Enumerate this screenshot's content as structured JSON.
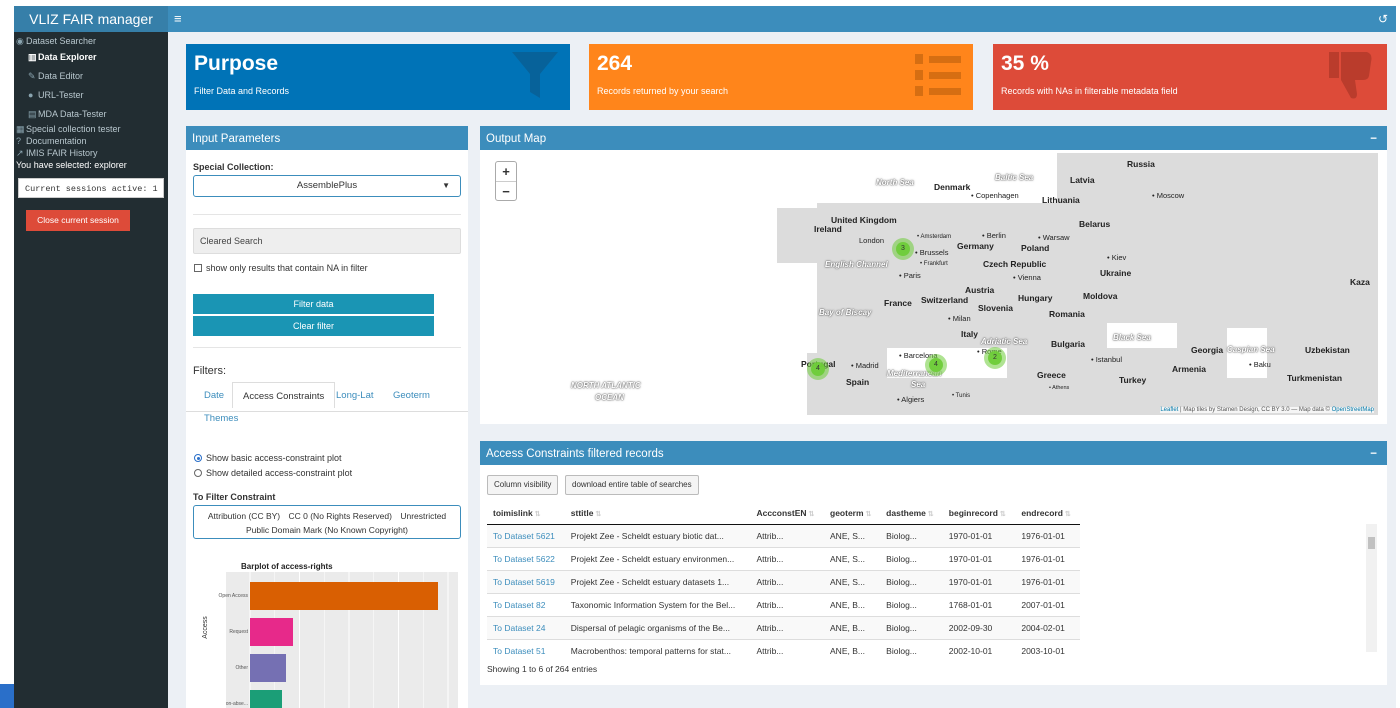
{
  "app": {
    "title": "VLIZ FAIR manager"
  },
  "sidebar": {
    "items": [
      {
        "label": "Dataset Searcher",
        "icon": "eye-icon"
      },
      {
        "label": "Data Explorer",
        "icon": "map-icon"
      },
      {
        "label": "Data Editor",
        "icon": "edit-icon"
      },
      {
        "label": "URL-Tester",
        "icon": "globe-icon"
      },
      {
        "label": "MDA Data-Tester",
        "icon": "database-icon"
      },
      {
        "label": "Special collection tester",
        "icon": "table-icon"
      },
      {
        "label": "Documentation",
        "icon": "question-icon"
      },
      {
        "label": "IMIS FAIR History",
        "icon": "chart-icon"
      }
    ],
    "selected_text": "You have selected: explorer",
    "sessions_text": "Current sessions active: 1",
    "close_session_label": "Close current session"
  },
  "infoboxes": {
    "purpose": {
      "title": "Purpose",
      "subtitle": "Filter Data and Records",
      "color": "#0073b7"
    },
    "records": {
      "title": "264",
      "subtitle": "Records returned by your search",
      "color": "#ff851b"
    },
    "na": {
      "title": "35 %",
      "subtitle": "Records with NAs in filterable metadata field",
      "color": "#dd4b39"
    }
  },
  "input_params": {
    "title": "Input Parameters",
    "special_collection_label": "Special Collection:",
    "special_collection_value": "AssemblePlus",
    "search_value": "Cleared Search",
    "na_checkbox_label": "show only results that contain NA in filter",
    "filter_button": "Filter data",
    "clear_button": "Clear filter",
    "filters_label": "Filters:",
    "tabs": [
      "Date",
      "Access Constraints",
      "Long-Lat",
      "Geoterm",
      "Themes"
    ],
    "active_tab": "Access Constraints",
    "radio_basic": "Show basic access-constraint plot",
    "radio_detailed": "Show detailed access-constraint plot",
    "to_filter_label": "To Filter Constraint",
    "constraints": [
      "Attribution (CC BY)",
      "CC 0 (No Rights Reserved)",
      "Unrestricted",
      "Public Domain Mark (No Known Copyright)"
    ]
  },
  "chart_data": {
    "type": "bar",
    "title": "Barplot of access-rights",
    "ylabel": "Access",
    "categories": [
      "Open Access",
      "Request",
      "Other",
      "on-abse..."
    ],
    "values": [
      10,
      2.3,
      1.9,
      1.7
    ],
    "colors": [
      "#d95f02",
      "#e7298a",
      "#7570b3",
      "#1b9e77"
    ]
  },
  "output_map": {
    "title": "Output Map",
    "zoom_in": "+",
    "zoom_out": "−",
    "attribution_leaflet": "Leaflet",
    "attribution_text": "| Map tiles by Stamen Design, CC BY 3.0 — Map data ©",
    "attribution_osm": "OpenStreetMap",
    "clusters": [
      "3",
      "4",
      "4",
      "2"
    ],
    "labels": {
      "russia": "Russia",
      "moscow": "Moscow",
      "latvia": "Latvia",
      "lithuania": "Lithuania",
      "belarus": "Belarus",
      "denmark": "Denmark",
      "copenhagen": "Copenhagen",
      "uk": "United Kingdom",
      "ireland": "Ireland",
      "london": "London",
      "amsterdam": "Amsterdam",
      "berlin": "Berlin",
      "warsaw": "Warsaw",
      "germany": "Germany",
      "poland": "Poland",
      "brussels": "Brussels",
      "frankfurt": "Frankfurt",
      "czech": "Czech Republic",
      "kiev": "Kiev",
      "ukraine": "Ukraine",
      "paris": "Paris",
      "vienna": "Vienna",
      "austria": "Austria",
      "hungary": "Hungary",
      "moldova": "Moldova",
      "france": "France",
      "switzerland": "Switzerland",
      "slovenia": "Slovenia",
      "milan": "Milan",
      "romania": "Romania",
      "italy": "Italy",
      "bulgaria": "Bulgaria",
      "rome": "Rome",
      "portugal": "Portugal",
      "madrid": "Madrid",
      "spain": "Spain",
      "barcelona": "Barcelona",
      "istanbul": "Istanbul",
      "georgia": "Georgia",
      "armenia": "Armenia",
      "baku": "Baku",
      "uzbekistan": "Uzbekistan",
      "turkmenistan": "Turkmenistan",
      "turkey": "Turkey",
      "greece": "Greece",
      "athens": "Athens",
      "algiers": "Algiers",
      "tunis": "Tunis",
      "kaza": "Kaza",
      "north_sea": "North Sea",
      "baltic_sea": "Baltic Sea",
      "english_channel": "English Channel",
      "bay_biscay": "Bay of Biscay",
      "adriatic": "Adriatic Sea",
      "black_sea": "Black Sea",
      "caspian": "Caspian Sea",
      "med1": "Mediterranean",
      "med2": "Sea",
      "atlantic1": "NORTH ATLANTIC",
      "atlantic2": "OCEAN"
    }
  },
  "access_table": {
    "title": "Access Constraints filtered records",
    "column_visibility": "Column visibility",
    "download_label": "download entire table of searches",
    "columns": [
      "toimislink",
      "sttitle",
      "AccconstEN",
      "geoterm",
      "dastheme",
      "beginrecord",
      "endrecord"
    ],
    "rows": [
      [
        "To Dataset 5621",
        "Projekt Zee - Scheldt estuary biotic dat...",
        "Attrib...",
        "ANE, S...",
        "Biolog...",
        "1970-01-01",
        "1976-01-01"
      ],
      [
        "To Dataset 5622",
        "Projekt Zee - Scheldt estuary environmen...",
        "Attrib...",
        "ANE, S...",
        "Biolog...",
        "1970-01-01",
        "1976-01-01"
      ],
      [
        "To Dataset 5619",
        "Projekt Zee - Scheldt estuary datasets 1...",
        "Attrib...",
        "ANE, S...",
        "Biolog...",
        "1970-01-01",
        "1976-01-01"
      ],
      [
        "To Dataset 82",
        "Taxonomic Information System for the Bel...",
        "Attrib...",
        "ANE, B...",
        "Biolog...",
        "1768-01-01",
        "2007-01-01"
      ],
      [
        "To Dataset 24",
        "Dispersal of pelagic organisms of the Be...",
        "Attrib...",
        "ANE, B...",
        "Biolog...",
        "2002-09-30",
        "2004-02-01"
      ],
      [
        "To Dataset 51",
        "Macrobenthos: temporal patterns for stat...",
        "Attrib...",
        "ANE, B...",
        "Biolog...",
        "2002-10-01",
        "2003-10-01"
      ]
    ],
    "info": "Showing 1 to 6 of 264 entries"
  }
}
